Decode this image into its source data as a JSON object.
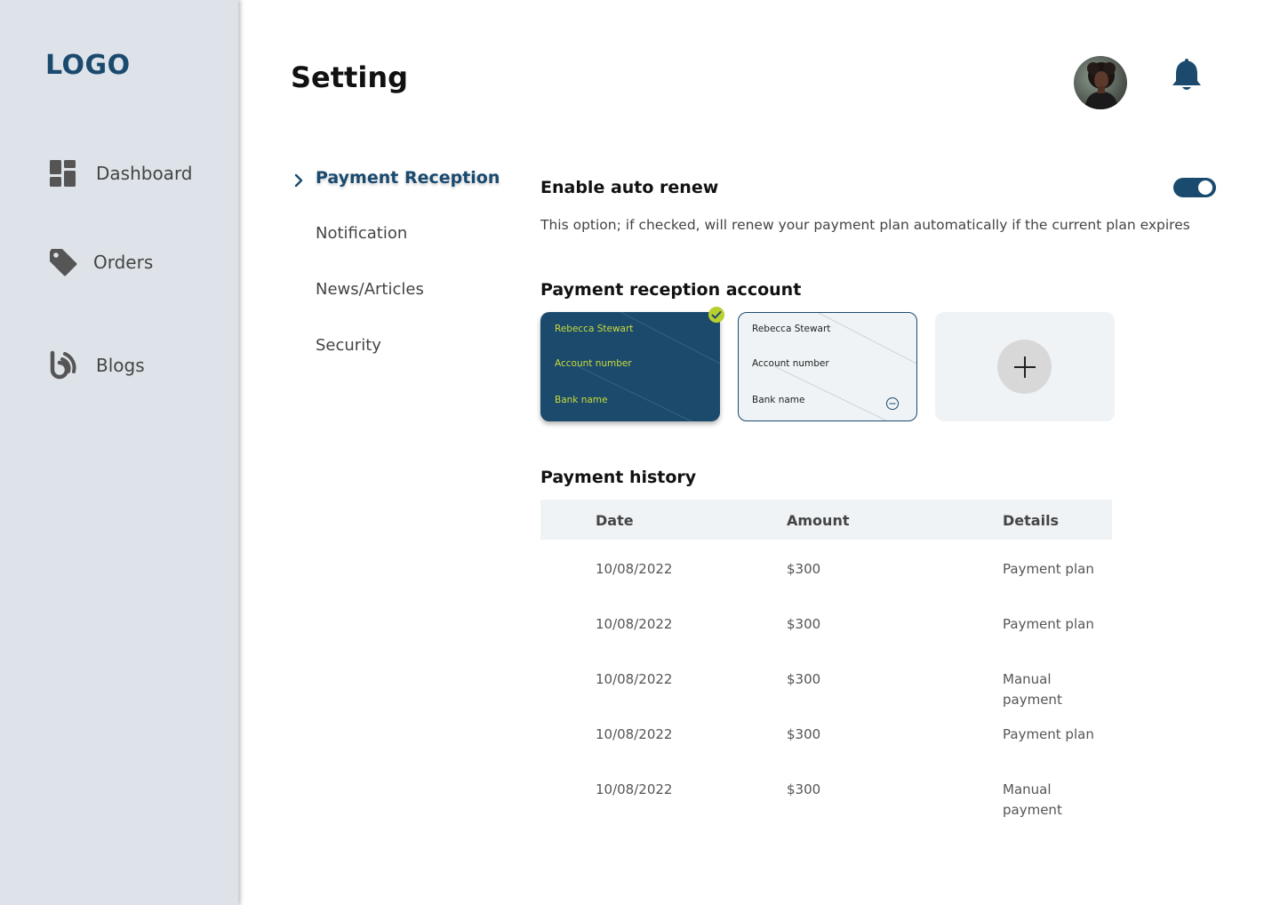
{
  "sidebar": {
    "logo": "LOGO",
    "items": [
      {
        "label": "Dashboard",
        "icon": "dashboard-icon"
      },
      {
        "label": "Orders",
        "icon": "tag-icon"
      },
      {
        "label": "Blogs",
        "icon": "blog-icon"
      }
    ]
  },
  "header": {
    "title": "Setting",
    "avatar_icon": "user-avatar",
    "notification_icon": "bell-icon"
  },
  "settings_nav": {
    "items": [
      {
        "label": "Payment Reception",
        "active": true
      },
      {
        "label": "Notification",
        "active": false
      },
      {
        "label": "News/Articles",
        "active": false
      },
      {
        "label": "Security",
        "active": false
      }
    ]
  },
  "auto_renew": {
    "title": "Enable auto renew",
    "description": "This option; if checked, will renew your payment plan automatically if the current plan expires",
    "enabled": true
  },
  "reception_account": {
    "title": "Payment reception account",
    "cards": [
      {
        "name": "Rebecca Stewart",
        "account": "Account number",
        "bank": "Bank name",
        "selected": true
      },
      {
        "name": "Rebecca Stewart",
        "account": "Account number",
        "bank": "Bank name",
        "selected": false
      }
    ]
  },
  "history": {
    "title": "Payment history",
    "columns": [
      "Date",
      "Amount",
      "Details"
    ],
    "rows": [
      {
        "date": "10/08/2022",
        "amount": "$300",
        "details": "Payment plan"
      },
      {
        "date": "10/08/2022",
        "amount": "$300",
        "details": "Payment plan"
      },
      {
        "date": "10/08/2022",
        "amount": "$300",
        "details": "Manual payment"
      },
      {
        "date": "10/08/2022",
        "amount": "$300",
        "details": "Payment plan"
      },
      {
        "date": "10/08/2022",
        "amount": "$300",
        "details": "Manual payment"
      }
    ]
  },
  "colors": {
    "primary": "#1a4a6e",
    "accent": "#c9dc38",
    "sidebar_bg": "#dde3e8",
    "panel_bg": "#eff3f6"
  }
}
